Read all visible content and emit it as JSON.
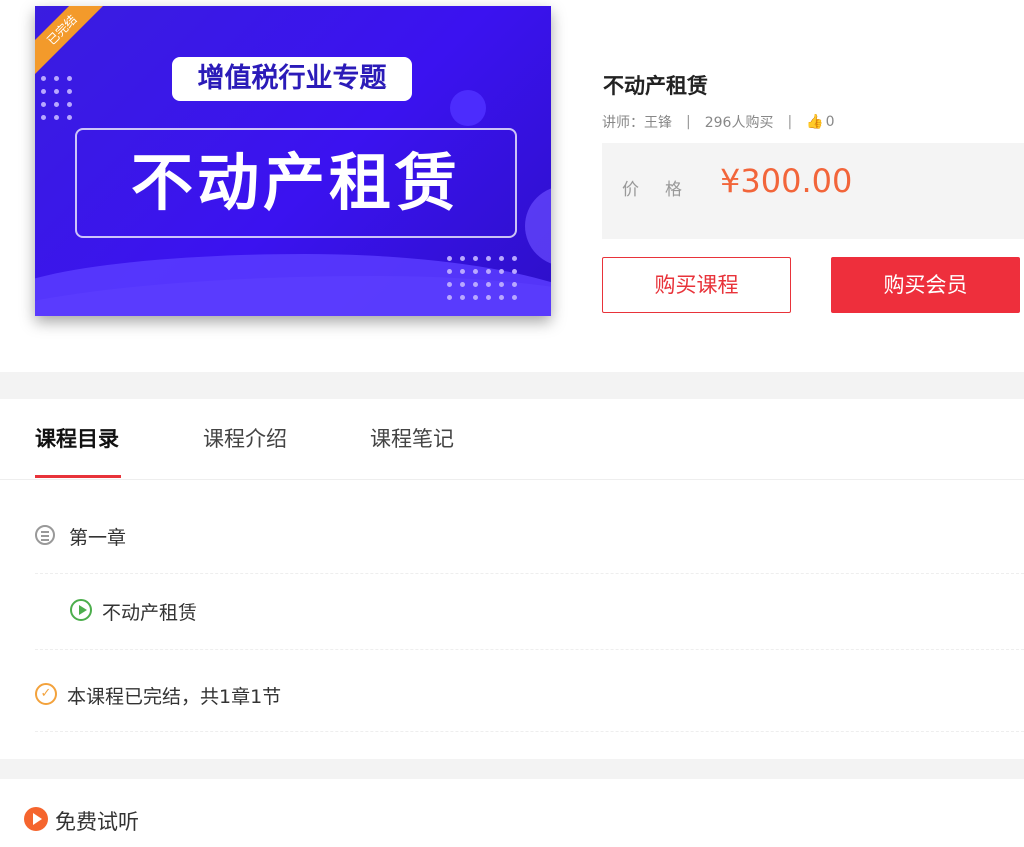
{
  "cover": {
    "corner_badge": "已完结",
    "subtitle": "增值税行业专题",
    "title": "不动产租赁"
  },
  "course": {
    "title": "不动产租赁",
    "teacher": "讲师：王锋",
    "purchases": "296人购买",
    "likes": "0",
    "price_label": "价格",
    "price": "¥300.00"
  },
  "buttons": {
    "buy_course": "购买课程",
    "buy_member": "购买会员"
  },
  "tabs": [
    {
      "label": "课程目录"
    },
    {
      "label": "课程介绍"
    },
    {
      "label": "课程笔记"
    }
  ],
  "catalog": {
    "chapter": "第一章",
    "lesson": "不动产租赁",
    "status": "本课程已完结，共1章1节"
  },
  "free_trial": {
    "label": "免费试听"
  },
  "colors": {
    "accent": "#e8333a",
    "price": "#f2653a",
    "cover_bg": "#3b12f0"
  }
}
